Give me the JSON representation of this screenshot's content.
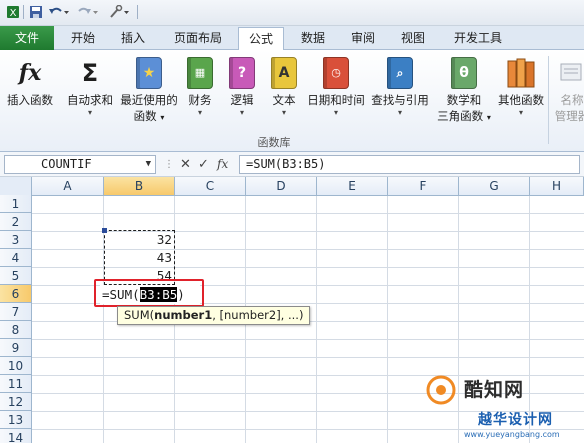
{
  "quick_access": {
    "icons": [
      "excel-icon",
      "save-icon",
      "undo-icon",
      "redo-icon",
      "customize-icon"
    ]
  },
  "tabs": [
    {
      "label": "文件",
      "kind": "file"
    },
    {
      "label": "开始"
    },
    {
      "label": "插入"
    },
    {
      "label": "页面布局"
    },
    {
      "label": "公式",
      "active": true
    },
    {
      "label": "数据"
    },
    {
      "label": "审阅"
    },
    {
      "label": "视图"
    },
    {
      "label": "开发工具"
    }
  ],
  "ribbon": {
    "group_label": "函数库",
    "buttons": [
      {
        "label1": "插入函数",
        "icon": "fx-icon"
      },
      {
        "label1": "自动求和",
        "icon": "sigma-icon",
        "dropdown": true
      },
      {
        "label1": "最近使用的",
        "label2": "函数",
        "icon": "star-book-icon",
        "dropdown": true
      },
      {
        "label1": "财务",
        "icon": "finance-book-icon",
        "dropdown": true
      },
      {
        "label1": "逻辑",
        "icon": "logic-book-icon",
        "dropdown": true
      },
      {
        "label1": "文本",
        "icon": "text-book-icon",
        "dropdown": true
      },
      {
        "label1": "日期和时间",
        "icon": "datetime-book-icon",
        "dropdown": true
      },
      {
        "label1": "查找与引用",
        "icon": "lookup-book-icon",
        "dropdown": true
      },
      {
        "label1": "数学和",
        "label2": "三角函数",
        "icon": "math-book-icon",
        "dropdown": true
      },
      {
        "label1": "其他函数",
        "icon": "more-books-icon",
        "dropdown": true
      },
      {
        "label1": "名称",
        "label2": "管理器",
        "icon": "name-manager-icon"
      }
    ],
    "glyphs": {
      "fx": "fx",
      "sigma": "Σ",
      "star": "★",
      "logic": "?",
      "text": "A",
      "theta": "θ"
    }
  },
  "formula_bar": {
    "name_box": "COUNTIF",
    "cancel_symbol": "✕",
    "enter_symbol": "✓",
    "fx_symbol": "fx",
    "formula": "=SUM(B3:B5)"
  },
  "sheet": {
    "columns": [
      "A",
      "B",
      "C",
      "D",
      "E",
      "F",
      "G",
      "H"
    ],
    "rows": [
      "1",
      "2",
      "3",
      "4",
      "5",
      "6",
      "7",
      "8",
      "9",
      "10",
      "11",
      "12",
      "13",
      "14"
    ],
    "selected_column": "B",
    "selected_row": "6",
    "cells": {
      "B3": "32",
      "B4": "43",
      "B5": "54"
    },
    "edit_prefix": "=SUM(",
    "edit_ref": "B3:B5",
    "edit_suffix": ")",
    "tooltip_fn": "SUM(",
    "tooltip_arg1": "number1",
    "tooltip_rest": ", [number2], ...)"
  },
  "watermark": {
    "line1": "酷知网",
    "line2": "越华设计网",
    "url": "www.yueyangbang.com"
  },
  "colors": {
    "file_tab": "#1f7a2f",
    "selection_header": "#f7c96b",
    "highlight_box": "#e0222b",
    "tooltip_bg": "#ffffe1"
  }
}
